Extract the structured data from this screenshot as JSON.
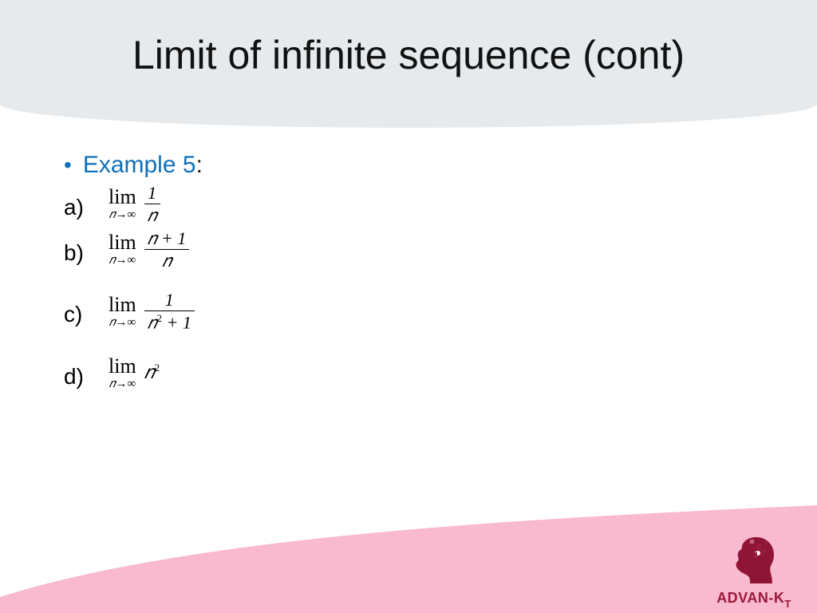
{
  "title": "Limit of infinite sequence (cont)",
  "bullet": "•",
  "example": {
    "label": "Example 5",
    "colon": ":"
  },
  "items": [
    {
      "letter": "a)",
      "lim": "lim",
      "sub": "𝑛→∞",
      "numerator": "1",
      "denominator": "𝑛"
    },
    {
      "letter": "b)",
      "lim": "lim",
      "sub": "𝑛→∞",
      "numerator": "𝑛 + 1",
      "denominator": "𝑛"
    },
    {
      "letter": "c)",
      "lim": "lim",
      "sub": "𝑛→∞",
      "numerator": "1",
      "denominator_base": "𝑛",
      "denominator_exp": "2",
      "denominator_tail": " + 1"
    },
    {
      "letter": "d)",
      "lim": "lim",
      "sub": "𝑛→∞",
      "term_base": "𝑛",
      "term_exp": "2"
    }
  ],
  "brand": {
    "name": "ADVAN-K",
    "suffix": "T"
  }
}
